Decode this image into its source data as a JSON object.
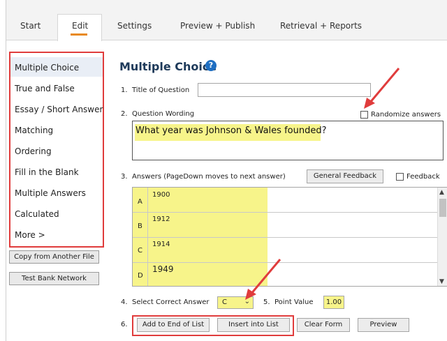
{
  "tabs": [
    {
      "label": "Start"
    },
    {
      "label": "Edit"
    },
    {
      "label": "Settings"
    },
    {
      "label": "Preview + Publish"
    },
    {
      "label": "Retrieval + Reports"
    }
  ],
  "sidebar": {
    "items": [
      {
        "label": "Multiple Choice"
      },
      {
        "label": "True and False"
      },
      {
        "label": "Essay / Short Answer"
      },
      {
        "label": "Matching"
      },
      {
        "label": "Ordering"
      },
      {
        "label": "Fill in the Blank"
      },
      {
        "label": "Multiple Answers"
      },
      {
        "label": "Calculated"
      },
      {
        "label": "More >"
      }
    ],
    "copy_button": "Copy from Another File",
    "network_button": "Test Bank Network"
  },
  "main": {
    "title": "Multiple Choice",
    "q1_number": "1.",
    "q1_label": "Title of Question",
    "q2_number": "2.",
    "q2_label": "Question Wording",
    "randomize_label": "Randomize answers",
    "wording_text": "What year was Johnson & Wales founded?",
    "q3_number": "3.",
    "answers_label": "Answers  (PageDown moves to next answer)",
    "general_feedback_button": "General Feedback",
    "feedback_label": "Feedback",
    "answers": [
      {
        "letter": "A",
        "value": "1900"
      },
      {
        "letter": "B",
        "value": "1912"
      },
      {
        "letter": "C",
        "value": "1914"
      },
      {
        "letter": "D",
        "value": "1949"
      }
    ],
    "q4_number": "4.",
    "select_label": "Select Correct Answer",
    "selected_answer": "C",
    "q5_number": "5.",
    "point_label": "Point Value",
    "point_value": "1.00",
    "q6_number": "6.",
    "add_end_button": "Add to End of List",
    "insert_button": "Insert into List",
    "clear_button": "Clear Form",
    "preview_button": "Preview"
  },
  "colors": {
    "highlight": "#f7f48a",
    "callout_red": "#e03c3c",
    "accent_orange": "#e8891c",
    "title_blue": "#1e3a5a",
    "help_blue": "#1f6fc2"
  }
}
